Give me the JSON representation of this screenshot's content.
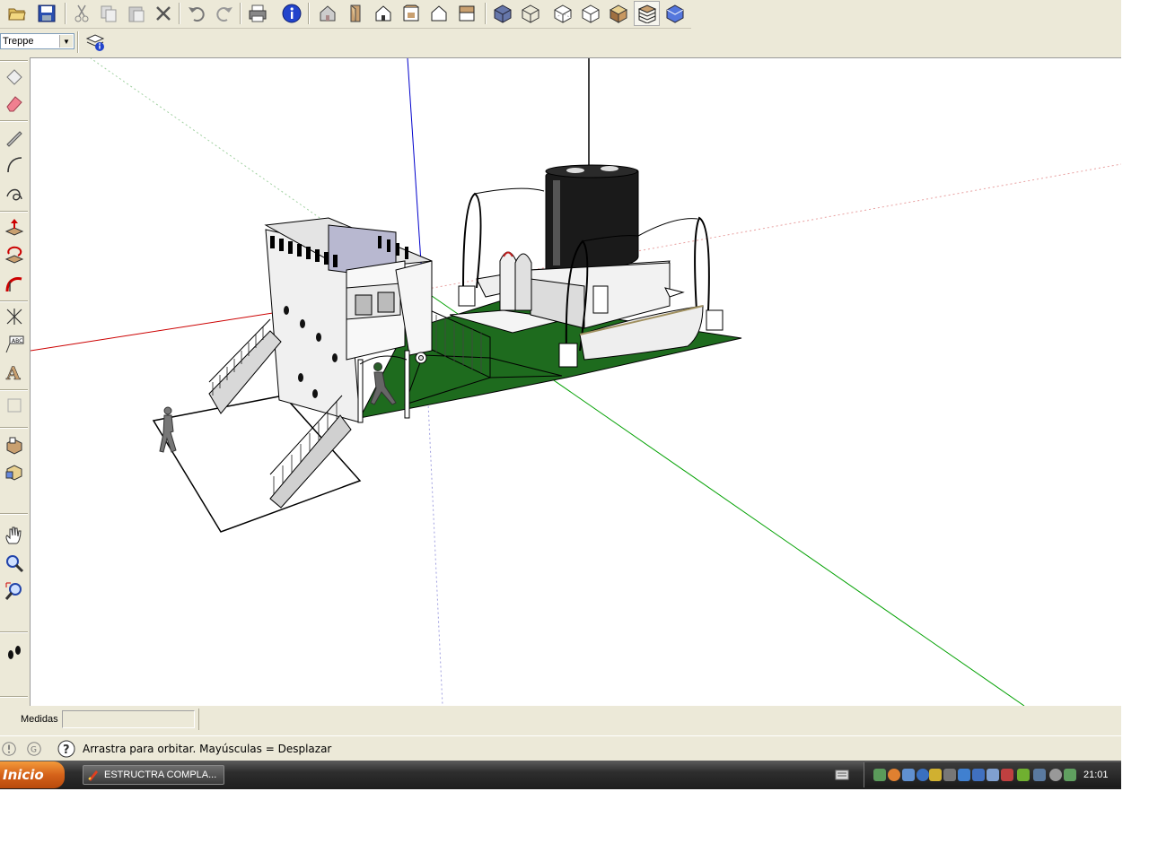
{
  "toolbar": {
    "items": [
      "folder-open-icon",
      "save-icon",
      "cut-icon",
      "copy-icon",
      "paste-icon",
      "erase-x-icon",
      "undo-icon",
      "redo-icon",
      "print-icon",
      "model-info-icon",
      "iso-view-icon",
      "top-view-icon",
      "front-view-icon",
      "right-view-icon",
      "back-view-icon",
      "left-view-icon",
      "xray-icon",
      "wireframe-icon",
      "hidden-line-icon",
      "shaded-icon",
      "shaded-texture-icon",
      "monochrome-icon"
    ]
  },
  "layers": {
    "current": "Treppe"
  },
  "left_tools": [
    "select-icon",
    "eraser-icon",
    "pencil-icon",
    "arc-icon",
    "freehand-icon",
    "push-pull-icon",
    "rotate-icon",
    "follow-me-icon",
    "dimension-icon",
    "text-label-icon",
    "3d-text-icon",
    "section-icon",
    "component-icon",
    "orbit-icon",
    "zoom-icon",
    "zoom-window-icon",
    "walk-icon"
  ],
  "measure": {
    "label": "Medidas",
    "value": ""
  },
  "status": {
    "hint": "Arrastra para orbitar. Mayúsculas = Desplazar"
  },
  "taskbar": {
    "start_label": "Inicio",
    "window_title": "ESTRUCTRA COMPLA...",
    "clock": "21:01"
  },
  "colors": {
    "ui_bg": "#ece9d8",
    "grass": "#1e6b1e",
    "axis_red": "#cc0000",
    "axis_green": "#00a000",
    "axis_blue": "#0000cc",
    "funnel": "#1a1a1a"
  }
}
